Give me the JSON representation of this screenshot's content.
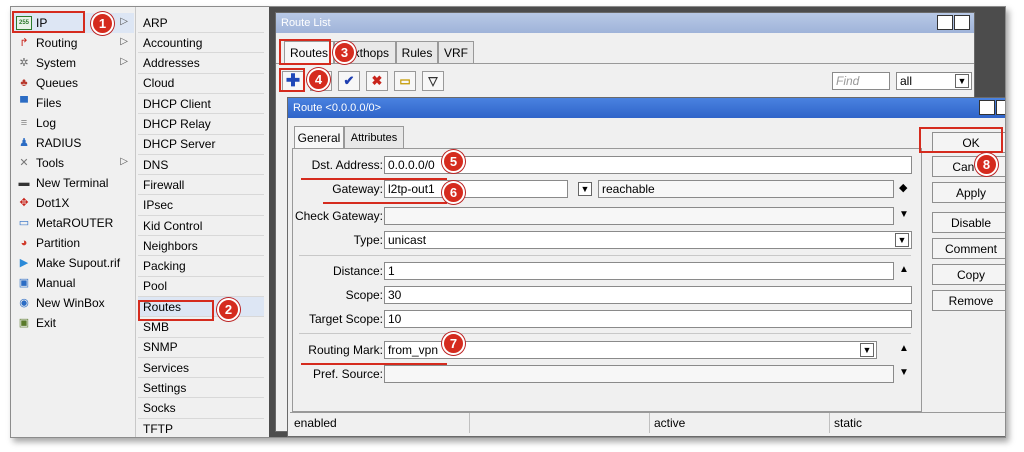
{
  "left_menu": [
    {
      "label": "IP",
      "icon": "ip-icon",
      "arrow": "▷"
    },
    {
      "label": "Routing",
      "icon": "routing-icon",
      "arrow": "▷"
    },
    {
      "label": "System",
      "icon": "system-gear-icon",
      "arrow": "▷"
    },
    {
      "label": "Queues",
      "icon": "queues-icon",
      "arrow": ""
    },
    {
      "label": "Files",
      "icon": "folder-icon",
      "arrow": ""
    },
    {
      "label": "Log",
      "icon": "log-icon",
      "arrow": ""
    },
    {
      "label": "RADIUS",
      "icon": "radius-users-icon",
      "arrow": ""
    },
    {
      "label": "Tools",
      "icon": "tools-icon",
      "arrow": "▷"
    },
    {
      "label": "New Terminal",
      "icon": "terminal-icon",
      "arrow": ""
    },
    {
      "label": "Dot1X",
      "icon": "dot1x-icon",
      "arrow": ""
    },
    {
      "label": "MetaROUTER",
      "icon": "metarouter-icon",
      "arrow": ""
    },
    {
      "label": "Partition",
      "icon": "partition-icon",
      "arrow": ""
    },
    {
      "label": "Make Supout.rif",
      "icon": "supout-icon",
      "arrow": ""
    },
    {
      "label": "Manual",
      "icon": "manual-icon",
      "arrow": ""
    },
    {
      "label": "New WinBox",
      "icon": "winbox-icon",
      "arrow": ""
    },
    {
      "label": "Exit",
      "icon": "exit-icon",
      "arrow": ""
    }
  ],
  "ip_submenu": [
    "ARP",
    "Accounting",
    "Addresses",
    "Cloud",
    "DHCP Client",
    "DHCP Relay",
    "DHCP Server",
    "DNS",
    "Firewall",
    "IPsec",
    "Kid Control",
    "Neighbors",
    "Packing",
    "Pool",
    "Routes",
    "SMB",
    "SNMP",
    "Services",
    "Settings",
    "Socks",
    "TFTP"
  ],
  "route_list": {
    "title": "Route List",
    "tabs": [
      "Routes",
      "Nexthops",
      "Rules",
      "VRF"
    ],
    "find_placeholder": "Find",
    "filter_value": "all"
  },
  "route_window": {
    "title": "Route <0.0.0.0/0>",
    "tabs": [
      "General",
      "Attributes"
    ],
    "fields": {
      "dst_address": {
        "label": "Dst. Address:",
        "value": "0.0.0.0/0"
      },
      "gateway": {
        "label": "Gateway:",
        "value": "l2tp-out1",
        "state": "reachable"
      },
      "check_gateway": {
        "label": "Check Gateway:",
        "value": ""
      },
      "type": {
        "label": "Type:",
        "value": "unicast"
      },
      "distance": {
        "label": "Distance:",
        "value": "1"
      },
      "scope": {
        "label": "Scope:",
        "value": "30"
      },
      "target_scope": {
        "label": "Target Scope:",
        "value": "10"
      },
      "routing_mark": {
        "label": "Routing Mark:",
        "value": "from_vpn"
      },
      "pref_source": {
        "label": "Pref. Source:",
        "value": ""
      }
    },
    "buttons": [
      "OK",
      "Cancel",
      "Apply",
      "Disable",
      "Comment",
      "Copy",
      "Remove"
    ],
    "status": [
      "enabled",
      "",
      "active",
      "static"
    ]
  },
  "annotations": [
    "1",
    "2",
    "3",
    "4",
    "5",
    "6",
    "7",
    "8"
  ],
  "colors": {
    "highlight": "#d52b1e",
    "title_active": "#3a6ed8",
    "title_inactive": "#9fb3d9"
  }
}
